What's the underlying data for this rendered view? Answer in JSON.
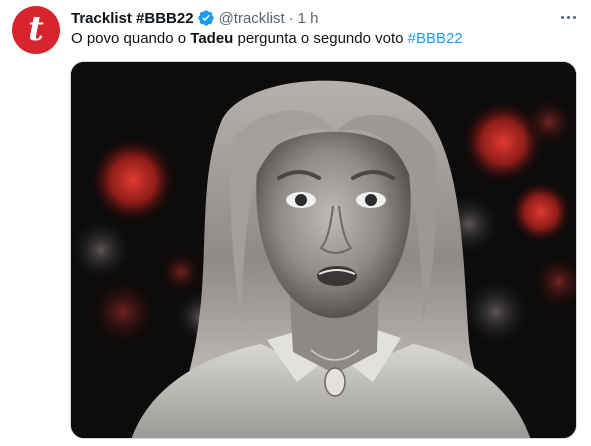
{
  "tweet": {
    "avatar_letter": "t",
    "display_name": "Tracklist #BBB22",
    "handle": "@tracklist",
    "separator": "·",
    "time": "1 h",
    "text_part1": "O povo quando o ",
    "text_bold": "Tadeu",
    "text_part2": " pergunta o segundo voto ",
    "hashtag": "#BBB22"
  },
  "colors": {
    "avatar_bg": "#d8242d",
    "verified": "#1d9bf0",
    "link": "#1d9bf0",
    "text": "#0f1419",
    "secondary": "#536471"
  },
  "icons": {
    "verified": "verified-badge-icon",
    "more": "more-options-icon"
  }
}
